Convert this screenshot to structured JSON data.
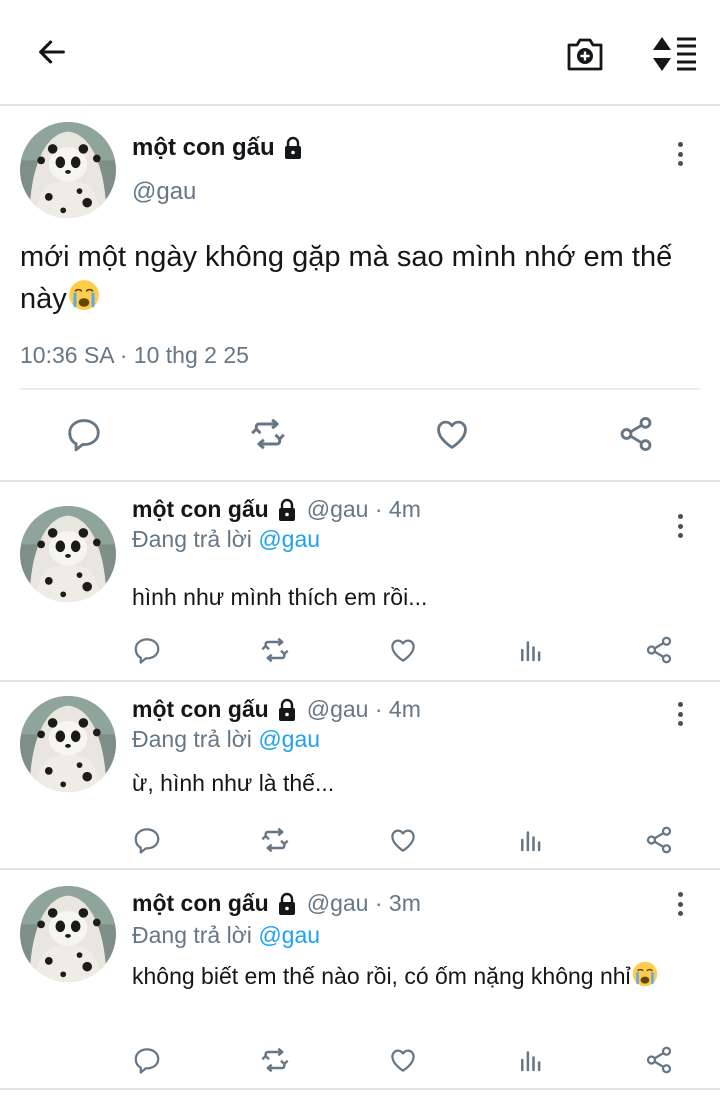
{
  "icons": {
    "back": "arrow-left-icon",
    "camera": "camera-plus-icon",
    "sort": "sort-list-icon",
    "lock": "lock-icon",
    "more": "more-vertical-icon",
    "reply": "reply-icon",
    "retweet": "retweet-icon",
    "like": "heart-icon",
    "share": "share-icon",
    "analytics": "analytics-icon",
    "emoji": "crying-face-emoji"
  },
  "colors": {
    "text": "#14171a",
    "secondary": "#657786",
    "link": "#1da1f2",
    "divider": "#e1e4e6"
  },
  "main_tweet": {
    "name": "một con gấu",
    "handle": "@gau",
    "text": "mới một ngày không gặp mà sao mình nhớ em thế này",
    "emoji": "😭",
    "timestamp": "10:36 SA · 10 thg 2 25"
  },
  "replies": [
    {
      "name": "một con gấu",
      "meta": "@gau · 4m",
      "replying_prefix": "Đang trả lời ",
      "replying_to": "@gau",
      "text": "hình như mình thích em rồi...",
      "emoji": ""
    },
    {
      "name": "một con gấu",
      "meta": "@gau · 4m",
      "replying_prefix": "Đang trả lời ",
      "replying_to": "@gau",
      "text": "ừ, hình như là thế...",
      "emoji": ""
    },
    {
      "name": "một con gấu",
      "meta": "@gau · 3m",
      "replying_prefix": "Đang trả lời ",
      "replying_to": "@gau",
      "text": "không biết em thế nào rồi, có ốm nặng không nhỉ",
      "emoji": "😭"
    }
  ]
}
